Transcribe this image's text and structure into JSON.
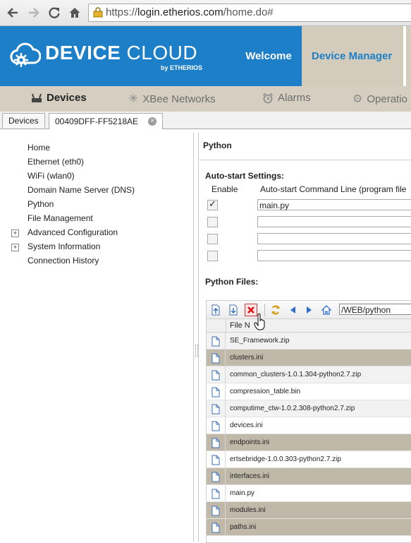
{
  "browser": {
    "url_scheme": "https://",
    "url_host": "login.etherios.com",
    "url_path": "/home.do#"
  },
  "header": {
    "brand_left": "DEVICE",
    "brand_right": " CLOUD",
    "brand_sub": "by ETHERIOS",
    "tabs": [
      {
        "label": "Welcome"
      },
      {
        "label": "Device Manager"
      }
    ]
  },
  "subnav": {
    "items": [
      {
        "label": "Devices",
        "icon": "router-icon"
      },
      {
        "label": "XBee Networks",
        "icon": "asterisk-icon"
      },
      {
        "label": "Alarms",
        "icon": "alarm-clock-icon"
      },
      {
        "label": "Operatio",
        "icon": "gear-icon"
      }
    ]
  },
  "tabs": {
    "items": [
      {
        "label": "Devices"
      },
      {
        "label": "00409DFF-FF5218AE"
      }
    ],
    "close_glyph": "×"
  },
  "sidebar": {
    "items": [
      {
        "label": "Home"
      },
      {
        "label": "Ethernet (eth0)"
      },
      {
        "label": "WiFi (wlan0)"
      },
      {
        "label": "Domain Name Server (DNS)"
      },
      {
        "label": "Python"
      },
      {
        "label": "File Management"
      },
      {
        "label": "Advanced Configuration",
        "expander": "+"
      },
      {
        "label": "System Information",
        "expander": "+"
      },
      {
        "label": "Connection History"
      }
    ]
  },
  "main": {
    "title": "Python",
    "autostart": {
      "heading": "Auto-start Settings:",
      "col_enable": "Enable",
      "col_command": "Auto-start Command Line (program file",
      "rows": [
        {
          "enabled": true,
          "command": "main.py"
        },
        {
          "enabled": false,
          "command": ""
        },
        {
          "enabled": false,
          "command": ""
        },
        {
          "enabled": false,
          "command": ""
        }
      ]
    },
    "files": {
      "heading": "Python Files:",
      "path": "/WEB/python",
      "column_header": "File N",
      "items": [
        {
          "name": "SE_Framework.zip",
          "style": "alt"
        },
        {
          "name": "clusters.ini",
          "style": "sel"
        },
        {
          "name": "common_clusters-1.0.1.304-python2.7.zip",
          "style": "alt"
        },
        {
          "name": "compression_table.bin",
          "style": "plain"
        },
        {
          "name": "computime_ctw-1.0.2.308-python2.7.zip",
          "style": "alt"
        },
        {
          "name": "devices.ini",
          "style": "plain"
        },
        {
          "name": "endpoints.ini",
          "style": "sel"
        },
        {
          "name": "ertsebridge-1.0.0.303-python2.7.zip",
          "style": "plain"
        },
        {
          "name": "interfaces.ini",
          "style": "sel"
        },
        {
          "name": "main.py",
          "style": "plain"
        },
        {
          "name": "modules.ini",
          "style": "sel"
        },
        {
          "name": "paths.ini",
          "style": "sel"
        }
      ]
    }
  },
  "colors": {
    "brand_blue": "#1c7fc8",
    "tab_beige": "#d3cbbb",
    "selected_row": "#c0b9a9"
  }
}
